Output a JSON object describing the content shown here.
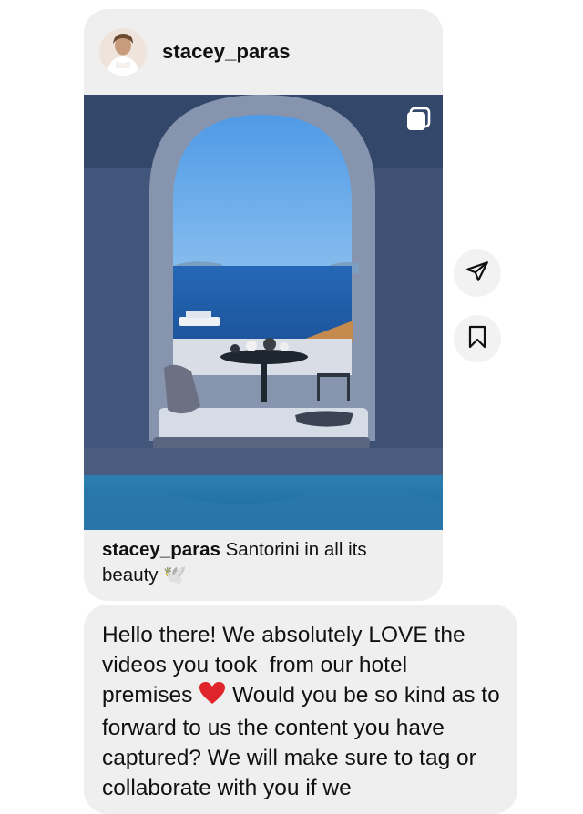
{
  "post": {
    "username": "stacey_paras",
    "caption_user": "stacey_paras",
    "caption_text": " Santorini in all its beauty ",
    "caption_emoji": "🕊️",
    "icons": {
      "multi_media": "multiple-posts-icon",
      "share": "send-icon",
      "save": "bookmark-icon"
    }
  },
  "message": {
    "text_before_heart": "Hello there! We absolutely LOVE the videos you took  from our hotel premises ",
    "heart": "❤️",
    "text_after_heart": " Would you be so kind as to forward to us the content you have captured? We will make sure to tag or collaborate with you if we"
  },
  "colors": {
    "bubble_bg": "#efeff0",
    "sky": "#6fb6f1",
    "sea": "#1c63b8",
    "wall": "#3c4e72",
    "pool": "#2f7fb1"
  }
}
